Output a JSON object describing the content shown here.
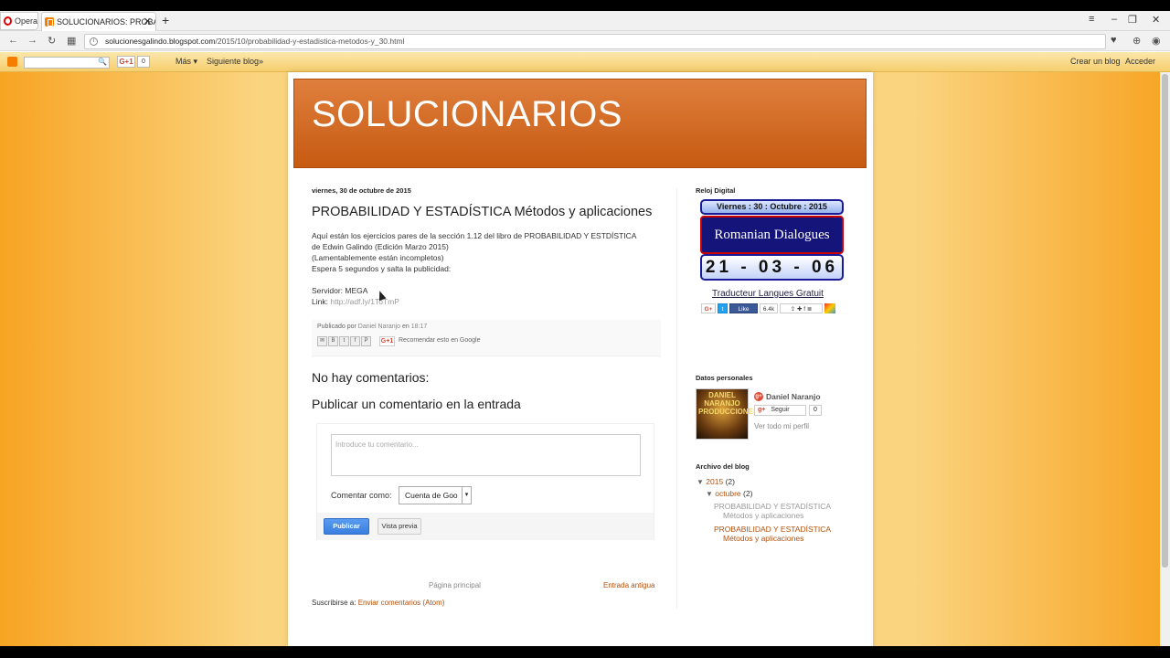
{
  "browser": {
    "opera_label": "Opera",
    "tab_title": "SOLUCIONARIOS: PROBAB",
    "url_host": "solucionesgalindo.blogspot.com",
    "url_path": "/2015/10/probabilidad-y-estadistica-metodos-y_30.html"
  },
  "bloggerbar": {
    "gplus_label": "G+1",
    "gplus_count": "0",
    "more_label": "Más ▾",
    "next_blog": "Siguiente blog»",
    "create_blog": "Crear un blog",
    "login": "Acceder"
  },
  "blog": {
    "title": "SOLUCIONARIOS"
  },
  "post": {
    "date": "viernes, 30 de octubre de 2015",
    "title": "PROBABILIDAD Y ESTADÍSTICA Métodos y aplicaciones",
    "line1": "Aquí están los ejercicios pares de la sección 1.12 del libro de PROBABILIDAD Y ESTDÍSTICA",
    "line2": "de Edwin Galindo (Edición Marzo 2015)",
    "line3": "(Lamentablemente están incompletos)",
    "line4": "Espera 5 segundos y salta la publicidad:",
    "server": "Servidor: MEGA",
    "link_label": "Link:",
    "link_url": "http://adf.ly/1ToTmP",
    "published_by": "Publicado por",
    "author": "Daniel Naranjo",
    "at": "en",
    "time": "18:17",
    "gplus": "G+1",
    "recommend": "Recomendar esto en Google"
  },
  "comments": {
    "none": "No hay comentarios:",
    "publish_heading": "Publicar un comentario en la entrada",
    "placeholder": "Introduce tu comentario...",
    "comment_as_label": "Comentar como:",
    "comment_as_value": "Cuenta de Goo",
    "publish_button": "Publicar",
    "preview_button": "Vista previa"
  },
  "pager": {
    "home": "Página principal",
    "older": "Entrada antigua",
    "subscribe_label": "Suscribirse a:",
    "subscribe_link": "Enviar comentarios (Atom)"
  },
  "sidebar": {
    "clock_heading": "Reloj Digital",
    "clock_date": "Viernes : 30 : Octubre : 2015",
    "clock_banner": "Romanian Dialogues",
    "clock_time": "21 - 03 - 06",
    "translator": "Traducteur Langues Gratuit",
    "like_label": "Like",
    "like_count": "6.4k",
    "profile_heading": "Datos personales",
    "profile_name": "Daniel Naranjo",
    "profile_image_text": "DANIEL NARANJO PRODUCCIONES",
    "follow_label": "Seguir",
    "follow_count": "0",
    "view_profile": "Ver todo mi perfil",
    "archive_heading": "Archivo del blog",
    "archive_year": "2015",
    "archive_year_count": "(2)",
    "archive_month": "octubre",
    "archive_month_count": "(2)",
    "archive_post_1_a": "PROBABILIDAD Y ESTADÍSTICA",
    "archive_post_1_b": "Métodos y aplicaciones",
    "archive_post_2_a": "PROBABILIDAD Y ESTADÍSTICA",
    "archive_post_2_b": "Métodos y aplicaciones"
  }
}
